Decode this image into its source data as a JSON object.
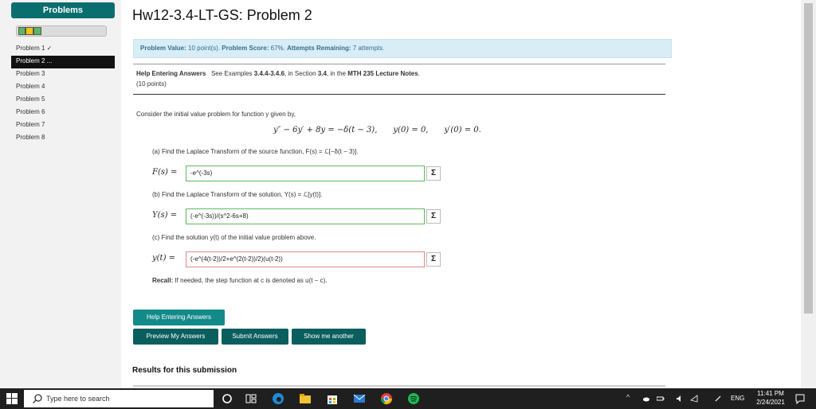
{
  "sidebar": {
    "header": "Problems",
    "items": [
      {
        "label": "Problem 1 ✓"
      },
      {
        "label": "Problem 2 ..."
      },
      {
        "label": "Problem 3"
      },
      {
        "label": "Problem 4"
      },
      {
        "label": "Problem 5"
      },
      {
        "label": "Problem 6"
      },
      {
        "label": "Problem 7"
      },
      {
        "label": "Problem 8"
      }
    ],
    "progress_colors": [
      "#5cb85c",
      "#f0c419",
      "#5cb85c"
    ]
  },
  "main": {
    "title": "Hw12-3.4-LT-GS: Problem 2",
    "status": {
      "problem_value_label": "Problem Value:",
      "problem_value": " 10 point(s). ",
      "score_label": "Problem Score:",
      "score": " 67%. ",
      "attempts_label": "Attempts Remaining:",
      "attempts": " 7 attempts."
    },
    "help": {
      "heading": "Help Entering Answers",
      "text_pre": "See Examples ",
      "examples": "3.4.4-3.4.6",
      "text_mid": ", in Section ",
      "section": "3.4",
      "text_mid2": ", in the ",
      "notes": "MTH 235 Lecture Notes",
      "text_end": ".",
      "points": "(10 points)"
    },
    "intro": "Consider the initial value problem for function y given by,",
    "equation": {
      "ode": "y″ − 6y′ + 8y = −δ(t − 3),",
      "ic1": "y(0) = 0,",
      "ic2": "y′(0) = 0."
    },
    "parts": {
      "a_text": "(a) Find the Laplace Transform of the source function, F(s) = ℒ[−δ(t − 3)].",
      "a_label": "F(s) =",
      "a_value": "-e^(-3s)",
      "b_text": "(b) Find the Laplace Transform of the solution, Y(s) = ℒ[y(t)].",
      "b_label": "Y(s) =",
      "b_value": "(-e^(-3s))/(s^2-6s+8)",
      "c_text": "(c) Find the solution y(t) of the initial value problem above.",
      "c_label": "y(t) =",
      "c_value": "(-e^(4(t-2))/2+e^(2(t-2))/2)(u(t-2))",
      "sigma": "Σ"
    },
    "recall": {
      "bold": "Recall:",
      "text": " If needed, the step function at c is denoted as u(t − c)."
    },
    "buttons": {
      "help": "Help Entering Answers",
      "preview": "Preview My Answers",
      "submit": "Submit Answers",
      "another": "Show me another"
    },
    "results_heading": "Results for this submission"
  },
  "taskbar": {
    "search_placeholder": "Type here to search",
    "lang": "ENG",
    "time": "11:41 PM",
    "date": "2/24/2021"
  }
}
